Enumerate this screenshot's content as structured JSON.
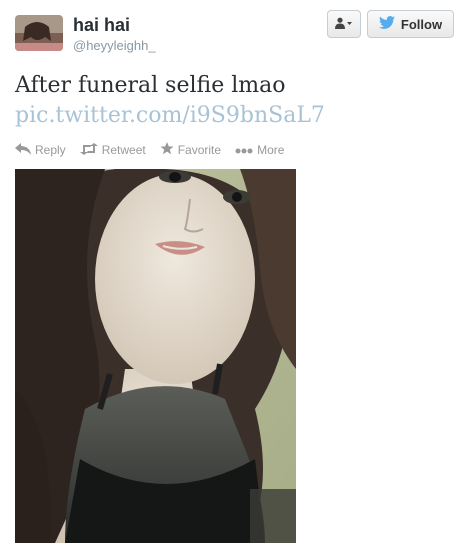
{
  "user": {
    "name": "hai hai",
    "handle": "@heyyleighh_"
  },
  "buttons": {
    "follow_label": "Follow"
  },
  "tweet": {
    "text": "After funeral selfie lmao",
    "link": "pic.twitter.com/i9S9bnSaL7"
  },
  "actions": {
    "reply": "Reply",
    "retweet": "Retweet",
    "favorite": "Favorite",
    "more": "More"
  },
  "icons": [
    "user-icon",
    "twitter-bird-icon",
    "reply-icon",
    "retweet-icon",
    "star-icon",
    "more-icon"
  ],
  "colors": {
    "link": "#a8c3d6",
    "brand_blue": "#55acee",
    "action_gray": "#999999"
  }
}
